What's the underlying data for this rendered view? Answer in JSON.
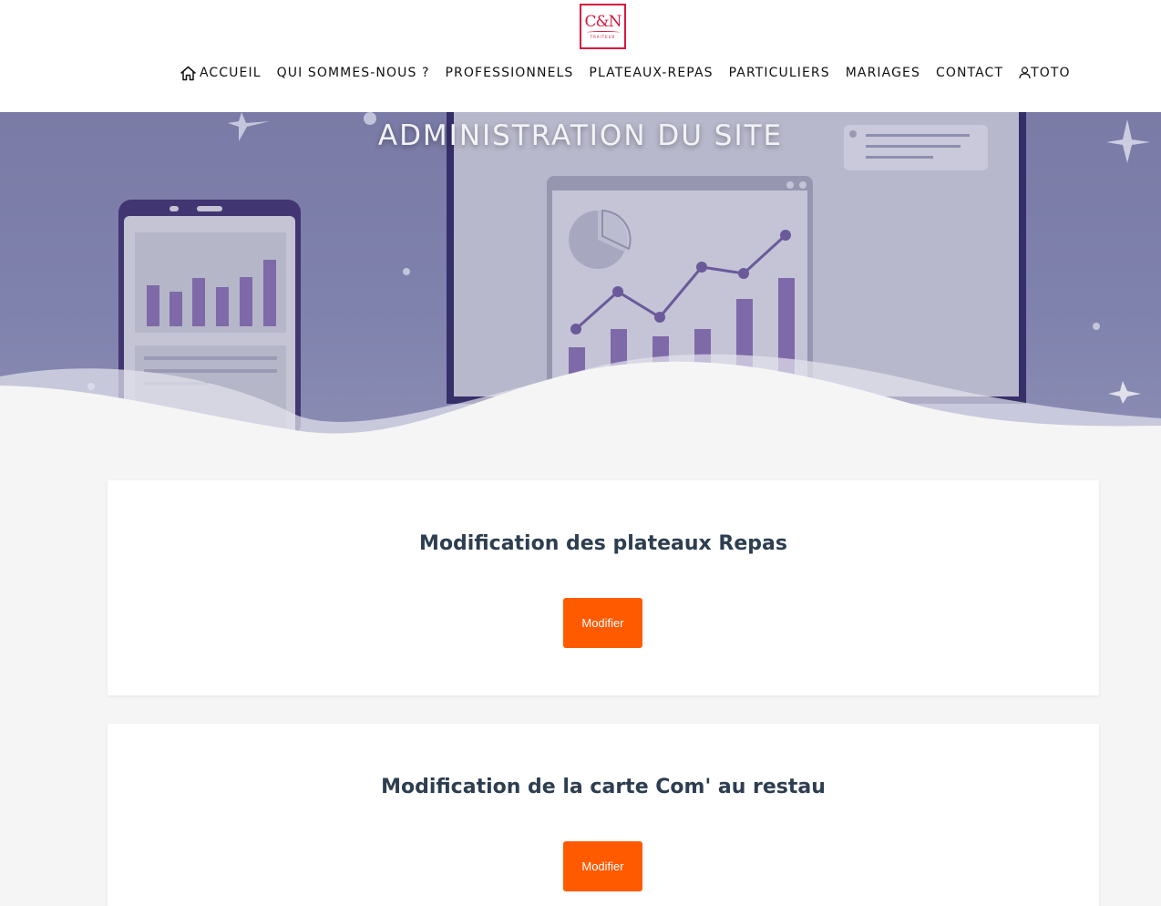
{
  "logo": {
    "mark": "C&N",
    "sub": "TRAITEUR"
  },
  "nav": {
    "items": [
      {
        "label": "ACCUEIL",
        "icon": "home-icon"
      },
      {
        "label": "QUI SOMMES-NOUS ?"
      },
      {
        "label": "PROFESSIONNELS"
      },
      {
        "label": "PLATEAUX-REPAS"
      },
      {
        "label": "PARTICULIERS"
      },
      {
        "label": "MARIAGES"
      },
      {
        "label": "CONTACT"
      },
      {
        "label": "TOTO",
        "icon": "user-icon"
      }
    ]
  },
  "hero": {
    "title": "ADMINISTRATION DU SITE"
  },
  "cards": [
    {
      "title": "Modification des plateaux Repas",
      "button_label": "Modifier"
    },
    {
      "title": "Modification de la carte Com' au restau",
      "button_label": "Modifier"
    }
  ],
  "colors": {
    "accent": "#ff5a00",
    "brand": "#d8163f",
    "heading": "#2d3e50",
    "hero_overlay": "#7f82ad"
  }
}
